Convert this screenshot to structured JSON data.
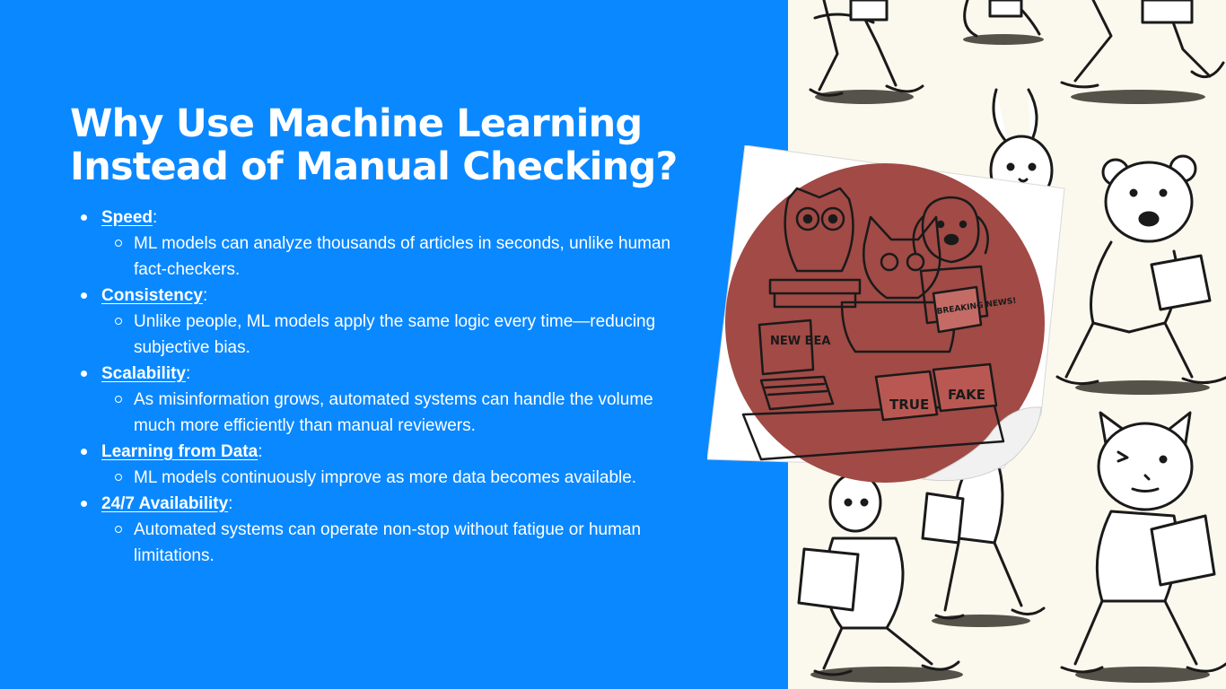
{
  "slide": {
    "title": "Why Use Machine Learning Instead of Manual Checking?",
    "bullets": [
      {
        "term": "Speed",
        "suffix": ":",
        "detail": "ML models can analyze thousands of articles in seconds, unlike human fact-checkers."
      },
      {
        "term": "Consistency",
        "suffix": ":",
        "detail": "Unlike people, ML models apply the same logic every time—reducing subjective bias."
      },
      {
        "term": "Scalability",
        "suffix": ":",
        "detail": "As misinformation grows, automated systems can handle the volume much more efficiently than manual reviewers."
      },
      {
        "term": "Learning from Data",
        "suffix": ":",
        "detail": "ML models continuously improve as more data becomes available."
      },
      {
        "term": "24/7 Availability",
        "suffix": ":",
        "detail": "Automated systems can operate non-stop without fatigue or human limitations."
      }
    ]
  },
  "illustration": {
    "newspaper_text": "NEW BEA",
    "breaking_news_text": "BREAKING NEWS!",
    "box_true_label": "TRUE",
    "box_fake_label": "FAKE"
  },
  "colors": {
    "background_blue": "#0a88ff",
    "cream_panel": "#fbf8ee",
    "sticker_red": "#a14a46",
    "ink": "#1a1a1a"
  }
}
